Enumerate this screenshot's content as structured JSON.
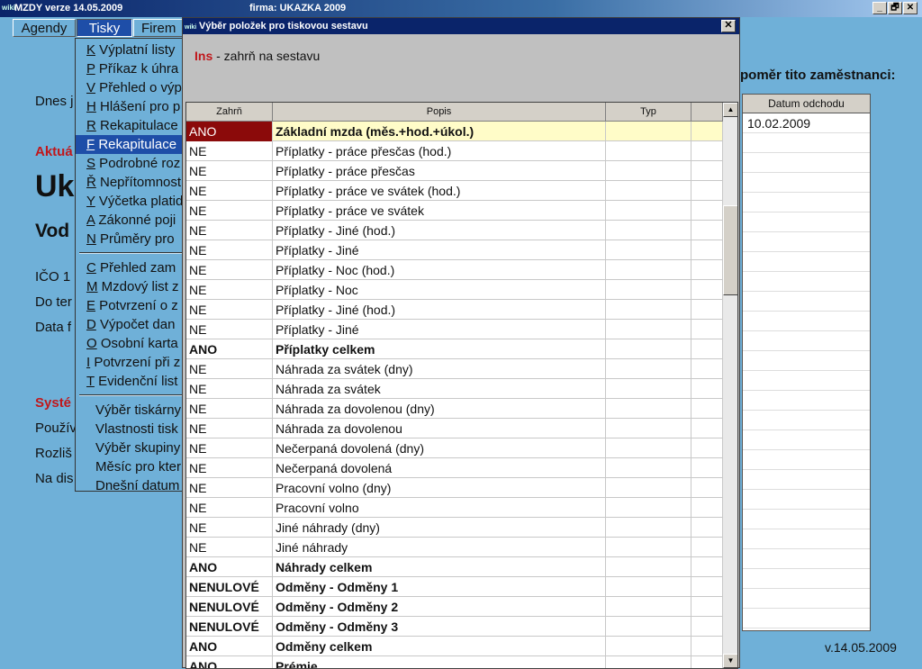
{
  "window": {
    "logo": "wiki",
    "app": "MZDY   verze 14.05.2009",
    "firm": "firma: UKAZKA 2009",
    "minimize": "_",
    "restore": "🗗",
    "close": "✕"
  },
  "menu": {
    "items": [
      "Agendy",
      "Tisky",
      "Firem"
    ]
  },
  "background": {
    "lines": [
      {
        "text": "Dnes j",
        "cls": ""
      },
      {
        "text": "Aktuá",
        "cls": "red"
      },
      {
        "text": "Uk",
        "cls": "big"
      },
      {
        "text": "Vod",
        "cls": "mid"
      },
      {
        "text": "IČO 1",
        "cls": ""
      },
      {
        "text": "Do ter",
        "cls": ""
      },
      {
        "text": "Data f",
        "cls": ""
      },
      {
        "text": "Systé",
        "cls": "red"
      },
      {
        "text": "Použív",
        "cls": ""
      },
      {
        "text": "Rozliš",
        "cls": ""
      },
      {
        "text": "Na dis",
        "cls": ""
      }
    ],
    "right_header": "poměr tito zaměstnanci:",
    "right_table": {
      "header": "Datum odchodu",
      "rows": [
        "10.02.2009"
      ]
    },
    "version": "v.14.05.2009"
  },
  "dropdown": {
    "group1": [
      {
        "key": "K",
        "label": " Výplatní listy"
      },
      {
        "key": "P",
        "label": " Příkaz k úhra"
      },
      {
        "key": "V",
        "label": " Přehled o výp"
      },
      {
        "key": "H",
        "label": " Hlášení pro p"
      },
      {
        "key": "R",
        "label": " Rekapitulace"
      },
      {
        "key": "F",
        "label": " Rekapitulace"
      },
      {
        "key": "S",
        "label": " Podrobné roz"
      },
      {
        "key": "Ř",
        "label": " Nepřítomnost"
      },
      {
        "key": "Y",
        "label": " Výčetka platid"
      },
      {
        "key": "A",
        "label": " Zákonné poji"
      },
      {
        "key": "N",
        "label": " Průměry pro"
      }
    ],
    "group2": [
      {
        "key": "C",
        "label": " Přehled zam"
      },
      {
        "key": "M",
        "label": " Mzdový list z"
      },
      {
        "key": "E",
        "label": " Potvrzení o z"
      },
      {
        "key": "D",
        "label": " Výpočet dan"
      },
      {
        "key": "O",
        "label": " Osobní karta"
      },
      {
        "key": "I",
        "label": " Potvrzení při z"
      },
      {
        "key": "T",
        "label": " Evidenční list"
      }
    ],
    "group3": [
      "Výběr tiskárny",
      "Vlastnosti tisk",
      "Výběr skupiny",
      "Měsíc pro kter",
      "Dnešní datum"
    ],
    "selected_index": 5
  },
  "dialog": {
    "title": "Výběr položek pro tiskovou sestavu",
    "hint_key": "Ins",
    "hint_text": " - zahrň na sestavu",
    "columns": [
      "Zahrň",
      "Popis",
      "Typ"
    ],
    "rows": [
      {
        "zahrn": "ANO",
        "popis": "Základní mzda (měs.+hod.+úkol.)",
        "typ": "",
        "bold": true
      },
      {
        "zahrn": "NE",
        "popis": "Příplatky - práce přesčas (hod.)",
        "typ": "",
        "bold": false
      },
      {
        "zahrn": "NE",
        "popis": "Příplatky - práce přesčas",
        "typ": "",
        "bold": false
      },
      {
        "zahrn": "NE",
        "popis": "Příplatky - práce ve svátek (hod.)",
        "typ": "",
        "bold": false
      },
      {
        "zahrn": "NE",
        "popis": "Příplatky - práce ve svátek",
        "typ": "",
        "bold": false
      },
      {
        "zahrn": "NE",
        "popis": "Příplatky - Jiné (hod.)",
        "typ": "",
        "bold": false
      },
      {
        "zahrn": "NE",
        "popis": "Příplatky - Jiné",
        "typ": "",
        "bold": false
      },
      {
        "zahrn": "NE",
        "popis": "Příplatky - Noc (hod.)",
        "typ": "",
        "bold": false
      },
      {
        "zahrn": "NE",
        "popis": "Příplatky - Noc",
        "typ": "",
        "bold": false
      },
      {
        "zahrn": "NE",
        "popis": "Příplatky - Jiné (hod.)",
        "typ": "",
        "bold": false
      },
      {
        "zahrn": "NE",
        "popis": "Příplatky - Jiné",
        "typ": "",
        "bold": false
      },
      {
        "zahrn": "ANO",
        "popis": "Příplatky celkem",
        "typ": "",
        "bold": true
      },
      {
        "zahrn": "NE",
        "popis": "Náhrada za svátek (dny)",
        "typ": "",
        "bold": false
      },
      {
        "zahrn": "NE",
        "popis": "Náhrada za svátek",
        "typ": "",
        "bold": false
      },
      {
        "zahrn": "NE",
        "popis": "Náhrada za dovolenou (dny)",
        "typ": "",
        "bold": false
      },
      {
        "zahrn": "NE",
        "popis": "Náhrada za dovolenou",
        "typ": "",
        "bold": false
      },
      {
        "zahrn": "NE",
        "popis": "Nečerpaná dovolená (dny)",
        "typ": "",
        "bold": false
      },
      {
        "zahrn": "NE",
        "popis": "Nečerpaná dovolená",
        "typ": "",
        "bold": false
      },
      {
        "zahrn": "NE",
        "popis": "Pracovní volno (dny)",
        "typ": "",
        "bold": false
      },
      {
        "zahrn": "NE",
        "popis": "Pracovní volno",
        "typ": "",
        "bold": false
      },
      {
        "zahrn": "NE",
        "popis": "Jiné náhrady (dny)",
        "typ": "",
        "bold": false
      },
      {
        "zahrn": "NE",
        "popis": "Jiné náhrady",
        "typ": "",
        "bold": false
      },
      {
        "zahrn": "ANO",
        "popis": "Náhrady celkem",
        "typ": "",
        "bold": true
      },
      {
        "zahrn": "NENULOVÉ",
        "popis": "Odměny - Odměny 1",
        "typ": "",
        "bold": true
      },
      {
        "zahrn": "NENULOVÉ",
        "popis": "Odměny - Odměny 2",
        "typ": "",
        "bold": true
      },
      {
        "zahrn": "NENULOVÉ",
        "popis": "Odměny - Odměny 3",
        "typ": "",
        "bold": true
      },
      {
        "zahrn": "ANO",
        "popis": "Odměny celkem",
        "typ": "",
        "bold": true
      },
      {
        "zahrn": "ANO",
        "popis": "Prémie",
        "typ": "",
        "bold": true
      }
    ],
    "selected_row": 0,
    "scroll_up": "▲",
    "scroll_down": "▼",
    "close": "✕"
  },
  "colors": {
    "background": "#6fb0d8",
    "selection": "#8b0a0a",
    "highlight_row": "#fffcc8",
    "accent_red": "#c0171b"
  }
}
